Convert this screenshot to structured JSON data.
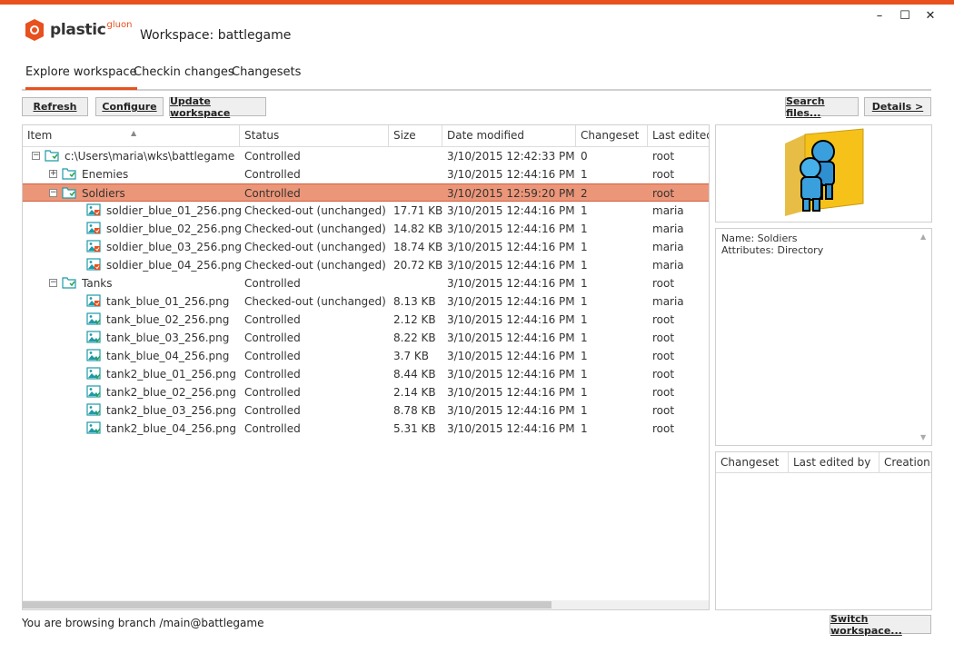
{
  "app": {
    "logo_text": "plastic",
    "logo_sub": "gluon",
    "workspace_title": "Workspace: battlegame"
  },
  "window": {
    "minimize": "–",
    "maximize": "☐",
    "close": "✕"
  },
  "tabs": [
    "Explore workspace",
    "Checkin changes",
    "Changesets"
  ],
  "toolbar": {
    "refresh": "Refresh",
    "configure": "Configure",
    "update": "Update workspace",
    "search": "Search files...",
    "details": "Details >"
  },
  "columns": [
    "Item",
    "Status",
    "Size",
    "Date modified",
    "Changeset",
    "Last edited"
  ],
  "rows": [
    {
      "name": "c:\\Users\\maria\\wks\\battlegame",
      "status": "Controlled",
      "size": "",
      "date": "3/10/2015 12:42:33 PM",
      "cs": "0",
      "user": "root",
      "kind": "folder",
      "expander": "minus"
    },
    {
      "name": "Enemies",
      "status": "Controlled",
      "size": "",
      "date": "3/10/2015 12:44:16 PM",
      "cs": "1",
      "user": "root",
      "kind": "folder",
      "expander": "plus"
    },
    {
      "name": "Soldiers",
      "status": "Controlled",
      "size": "",
      "date": "3/10/2015 12:59:20 PM",
      "cs": "2",
      "user": "root",
      "kind": "folder",
      "expander": "minus",
      "selected": true
    },
    {
      "name": "soldier_blue_01_256.png",
      "status": "Checked-out (unchanged)",
      "size": "17.71 KB",
      "date": "3/10/2015 12:44:16 PM",
      "cs": "1",
      "user": "maria",
      "kind": "image-co"
    },
    {
      "name": "soldier_blue_02_256.png",
      "status": "Checked-out (unchanged)",
      "size": "14.82 KB",
      "date": "3/10/2015 12:44:16 PM",
      "cs": "1",
      "user": "maria",
      "kind": "image-co"
    },
    {
      "name": "soldier_blue_03_256.png",
      "status": "Checked-out (unchanged)",
      "size": "18.74 KB",
      "date": "3/10/2015 12:44:16 PM",
      "cs": "1",
      "user": "maria",
      "kind": "image-co"
    },
    {
      "name": "soldier_blue_04_256.png",
      "status": "Checked-out (unchanged)",
      "size": "20.72 KB",
      "date": "3/10/2015 12:44:16 PM",
      "cs": "1",
      "user": "maria",
      "kind": "image-co"
    },
    {
      "name": "Tanks",
      "status": "Controlled",
      "size": "",
      "date": "3/10/2015 12:44:16 PM",
      "cs": "1",
      "user": "root",
      "kind": "folder",
      "expander": "minus"
    },
    {
      "name": "tank_blue_01_256.png",
      "status": "Checked-out (unchanged)",
      "size": "8.13 KB",
      "date": "3/10/2015 12:44:16 PM",
      "cs": "1",
      "user": "maria",
      "kind": "image-co"
    },
    {
      "name": "tank_blue_02_256.png",
      "status": "Controlled",
      "size": "2.12 KB",
      "date": "3/10/2015 12:44:16 PM",
      "cs": "1",
      "user": "root",
      "kind": "image"
    },
    {
      "name": "tank_blue_03_256.png",
      "status": "Controlled",
      "size": "8.22 KB",
      "date": "3/10/2015 12:44:16 PM",
      "cs": "1",
      "user": "root",
      "kind": "image"
    },
    {
      "name": "tank_blue_04_256.png",
      "status": "Controlled",
      "size": "3.7 KB",
      "date": "3/10/2015 12:44:16 PM",
      "cs": "1",
      "user": "root",
      "kind": "image"
    },
    {
      "name": "tank2_blue_01_256.png",
      "status": "Controlled",
      "size": "8.44 KB",
      "date": "3/10/2015 12:44:16 PM",
      "cs": "1",
      "user": "root",
      "kind": "image"
    },
    {
      "name": "tank2_blue_02_256.png",
      "status": "Controlled",
      "size": "2.14 KB",
      "date": "3/10/2015 12:44:16 PM",
      "cs": "1",
      "user": "root",
      "kind": "image"
    },
    {
      "name": "tank2_blue_03_256.png",
      "status": "Controlled",
      "size": "8.78 KB",
      "date": "3/10/2015 12:44:16 PM",
      "cs": "1",
      "user": "root",
      "kind": "image"
    },
    {
      "name": "tank2_blue_04_256.png",
      "status": "Controlled",
      "size": "5.31 KB",
      "date": "3/10/2015 12:44:16 PM",
      "cs": "1",
      "user": "root",
      "kind": "image"
    }
  ],
  "details": {
    "name_line": "Name: Soldiers",
    "attr_line": "Attributes: Directory"
  },
  "history_columns": [
    "Changeset",
    "Last edited by",
    "Creation date"
  ],
  "status_bar": {
    "branch_text": "You are browsing branch /main@battlegame",
    "switch_button": "Switch workspace..."
  },
  "colors": {
    "accent": "#e8501e",
    "selected_row": "#ec9679"
  }
}
